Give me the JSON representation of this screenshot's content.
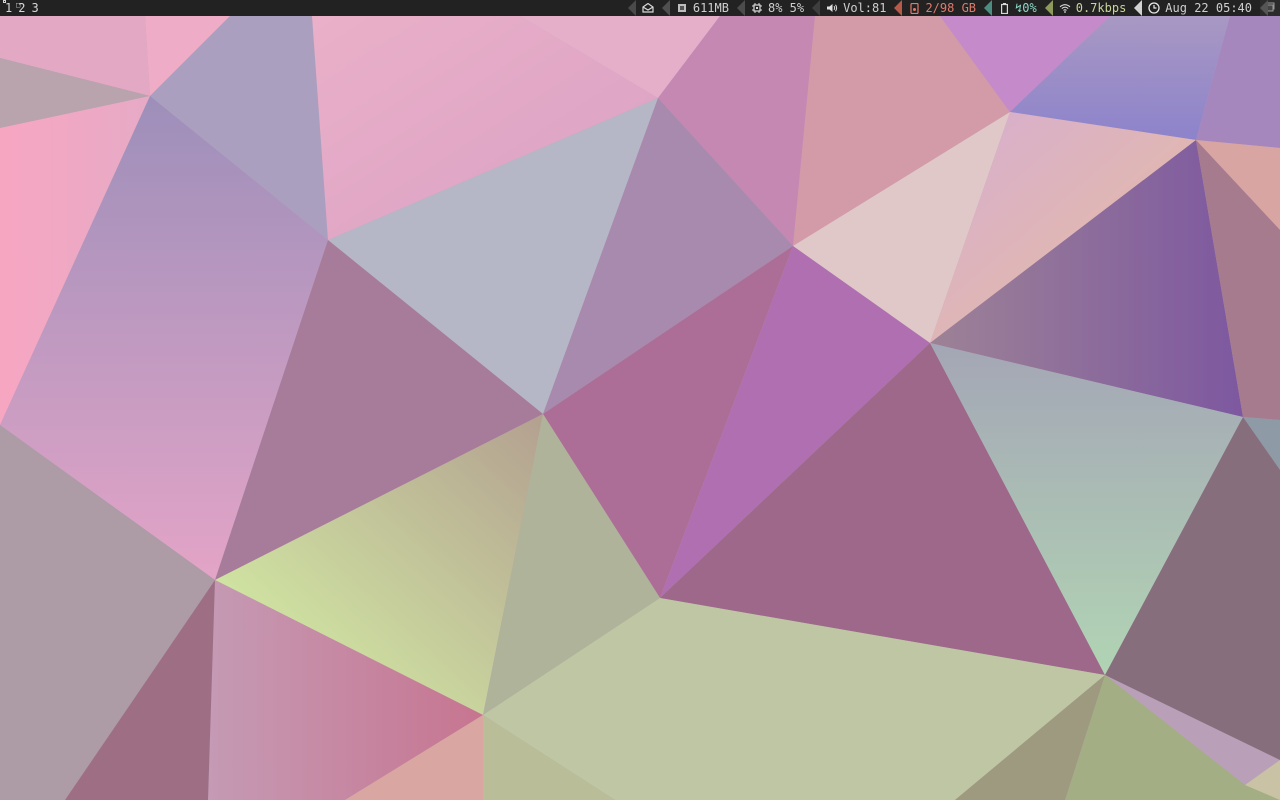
{
  "workspaces": [
    {
      "label": "1",
      "active": true
    },
    {
      "label": "2",
      "active": false
    },
    {
      "label": "3",
      "active": false
    }
  ],
  "status": {
    "mail": {
      "icon": "mail-icon",
      "edge": "#4a4a4a"
    },
    "memory": {
      "icon": "memory-icon",
      "value": "611MB",
      "edge": "#505050"
    },
    "cpu": {
      "icon": "cpu-icon",
      "value": "8% 5%",
      "edge": "#4c4c4c"
    },
    "volume": {
      "icon": "speaker-icon",
      "value": "Vol:81",
      "edge": "#3e3e3e"
    },
    "disk": {
      "icon": "disk-icon",
      "value": "2/98 GB",
      "color": "#e07a6a",
      "edge": "#b85a4a"
    },
    "battery": {
      "icon": "battery-icon",
      "value": "↯0%",
      "color": "#8fd7c7",
      "edge": "#4d8c80"
    },
    "network": {
      "icon": "wifi-icon",
      "value": "0.7kbps",
      "color": "#c9d59a",
      "edge": "#8e9a5c"
    },
    "clock": {
      "icon": "clock-icon",
      "value": "Aug 22 05:40",
      "edge": "#d2d2d2"
    },
    "tray": {
      "icon": "tray-icon"
    }
  },
  "colors": {
    "bar_bg": "#222222",
    "wallpaper_base": "#b9a0b8"
  }
}
